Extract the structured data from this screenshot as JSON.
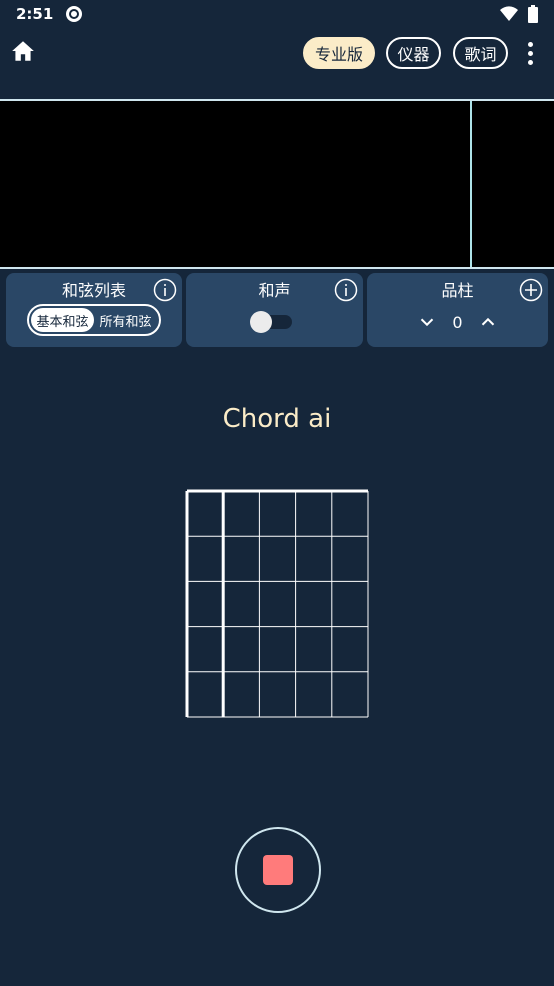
{
  "status": {
    "time": "2:51"
  },
  "appbar": {
    "pro_label": "专业版",
    "instrument_label": "仪器",
    "lyrics_label": "歌词"
  },
  "panels": {
    "chord_list": {
      "title": "和弦列表",
      "options": [
        "基本和弦",
        "所有和弦"
      ],
      "selected": "基本和弦"
    },
    "harmony": {
      "title": "和声",
      "enabled": false
    },
    "fret": {
      "title": "品柱",
      "value": "0"
    }
  },
  "chord": {
    "name": "Chord ai",
    "strings": 6,
    "frets": 5
  },
  "colors": {
    "background": "#15263a",
    "panel": "#2a4766",
    "accent": "#fbecc8",
    "record": "#ff7b7b"
  },
  "icons": [
    "home-icon",
    "more-vert-icon",
    "info-icon",
    "plus-circle-icon",
    "chevron-down-icon",
    "chevron-up-icon",
    "stop-icon",
    "wifi-icon",
    "battery-icon"
  ]
}
